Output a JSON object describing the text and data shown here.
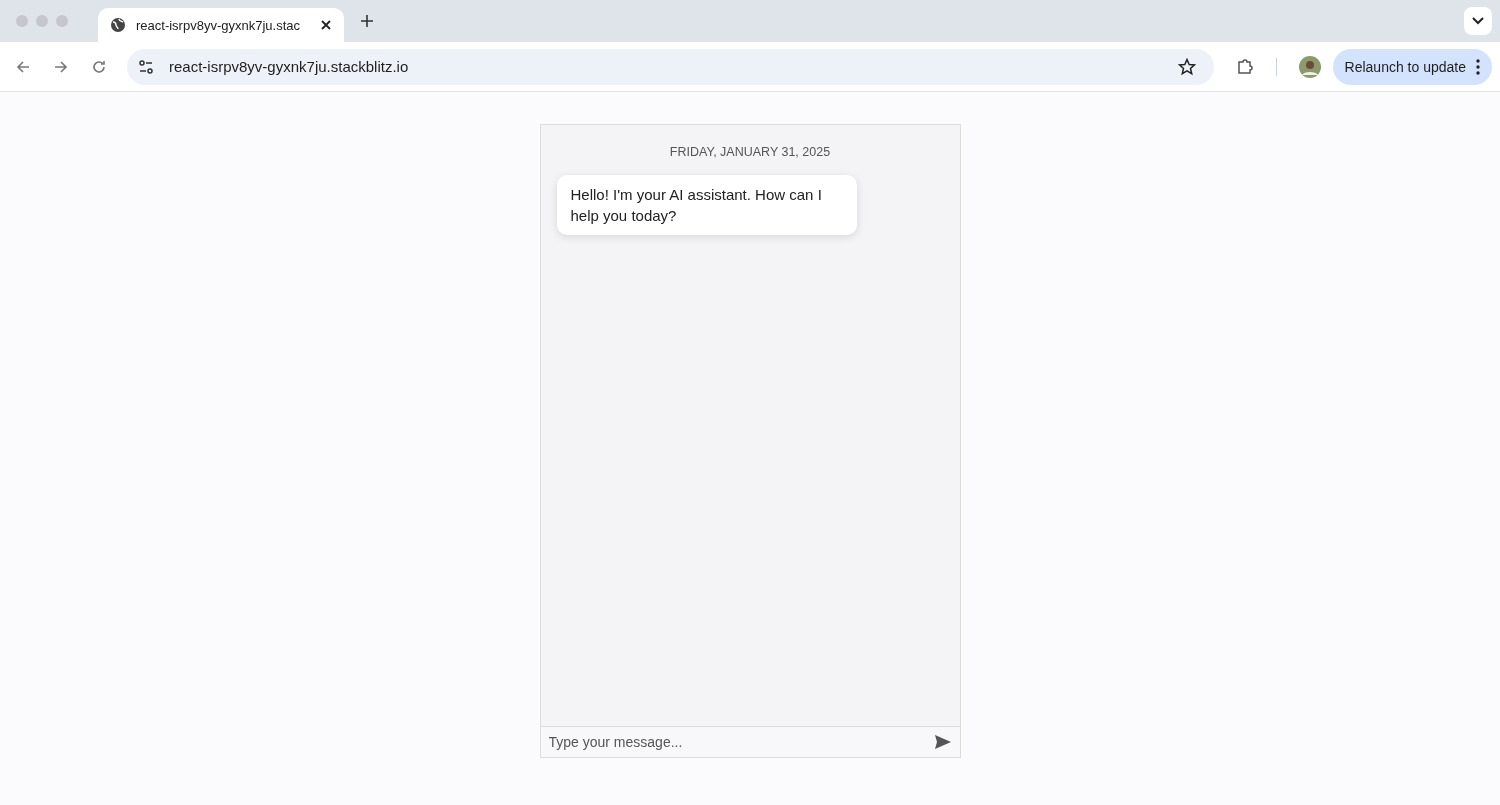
{
  "browser": {
    "tabs": [
      {
        "title": "react-isrpv8yv-gyxnk7ju.stac",
        "selected": true
      }
    ],
    "address": "react-isrpv8yv-gyxnk7ju.stackblitz.io",
    "relaunch_button": "Relaunch to update"
  },
  "chat": {
    "date": "FRIDAY, JANUARY 31, 2025",
    "messages": [
      {
        "text": "Hello! I'm your AI assistant. How can I help you today?"
      }
    ],
    "input": {
      "placeholder": "Type your message..."
    }
  }
}
